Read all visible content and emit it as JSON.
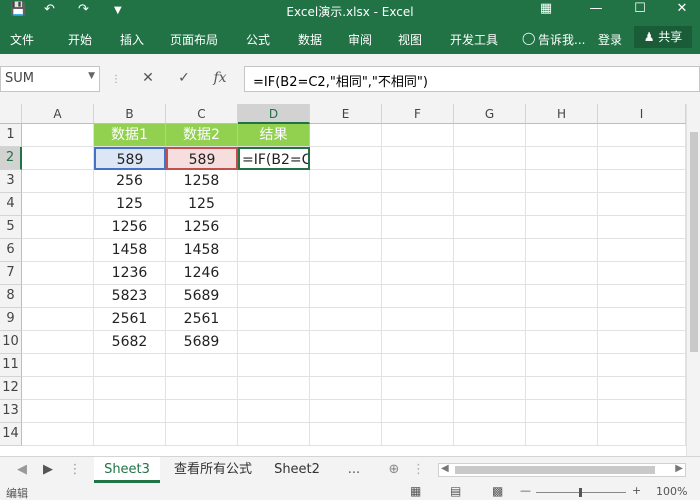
{
  "window": {
    "title": "Excel演示.xlsx - Excel"
  },
  "ribbon": {
    "tabs": [
      "文件",
      "开始",
      "插入",
      "页面布局",
      "公式",
      "数据",
      "审阅",
      "视图",
      "开发工具"
    ],
    "tell_me": "告诉我...",
    "login": "登录",
    "share": "共享"
  },
  "formula_bar": {
    "name_box": "SUM",
    "content": "=IF(B2=C2,\"相同\",\"不相同\")"
  },
  "columns": [
    "A",
    "B",
    "C",
    "D",
    "E",
    "F",
    "G",
    "H",
    "I"
  ],
  "rows": [
    "1",
    "2",
    "3",
    "4",
    "5",
    "6",
    "7",
    "8",
    "9",
    "10",
    "11",
    "12",
    "13",
    "14"
  ],
  "headers": {
    "b": "数据1",
    "c": "数据2",
    "d": "结果"
  },
  "data_b": [
    "589",
    "256",
    "125",
    "1256",
    "1458",
    "1236",
    "5823",
    "2561",
    "5682"
  ],
  "data_c": [
    "589",
    "1258",
    "125",
    "1256",
    "1458",
    "1246",
    "5689",
    "2561",
    "5689"
  ],
  "editing_cell": "=IF(B2=C",
  "sheets": [
    "Sheet3",
    "查看所有公式",
    "Sheet2"
  ],
  "status": {
    "mode": "编辑",
    "zoom": "100%"
  },
  "colors": {
    "excel_green": "#217346",
    "header_fill": "#92d050",
    "ref_blue": "#4472c4",
    "ref_red": "#c0504d"
  }
}
